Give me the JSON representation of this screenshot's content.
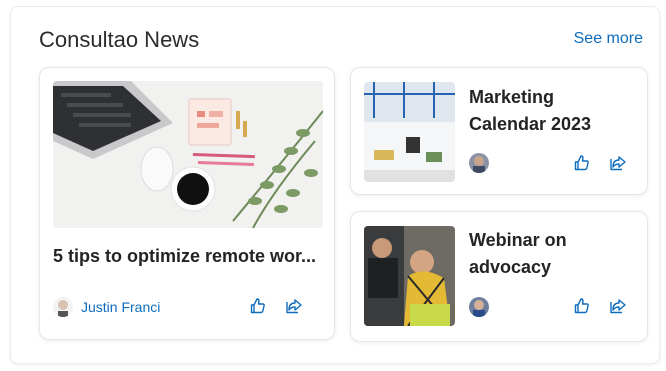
{
  "header": {
    "title": "Consultao News",
    "see_more": "See more"
  },
  "articles": [
    {
      "title": "5 tips to optimize remote wor...",
      "author": "Justin Franci"
    },
    {
      "title": "Marketing Calendar 2023"
    },
    {
      "title": "Webinar on advocacy"
    }
  ],
  "colors": {
    "accent": "#0f6cbd",
    "text": "#242424"
  },
  "icons": {
    "like": "thumbs-up-icon",
    "share": "share-icon"
  }
}
